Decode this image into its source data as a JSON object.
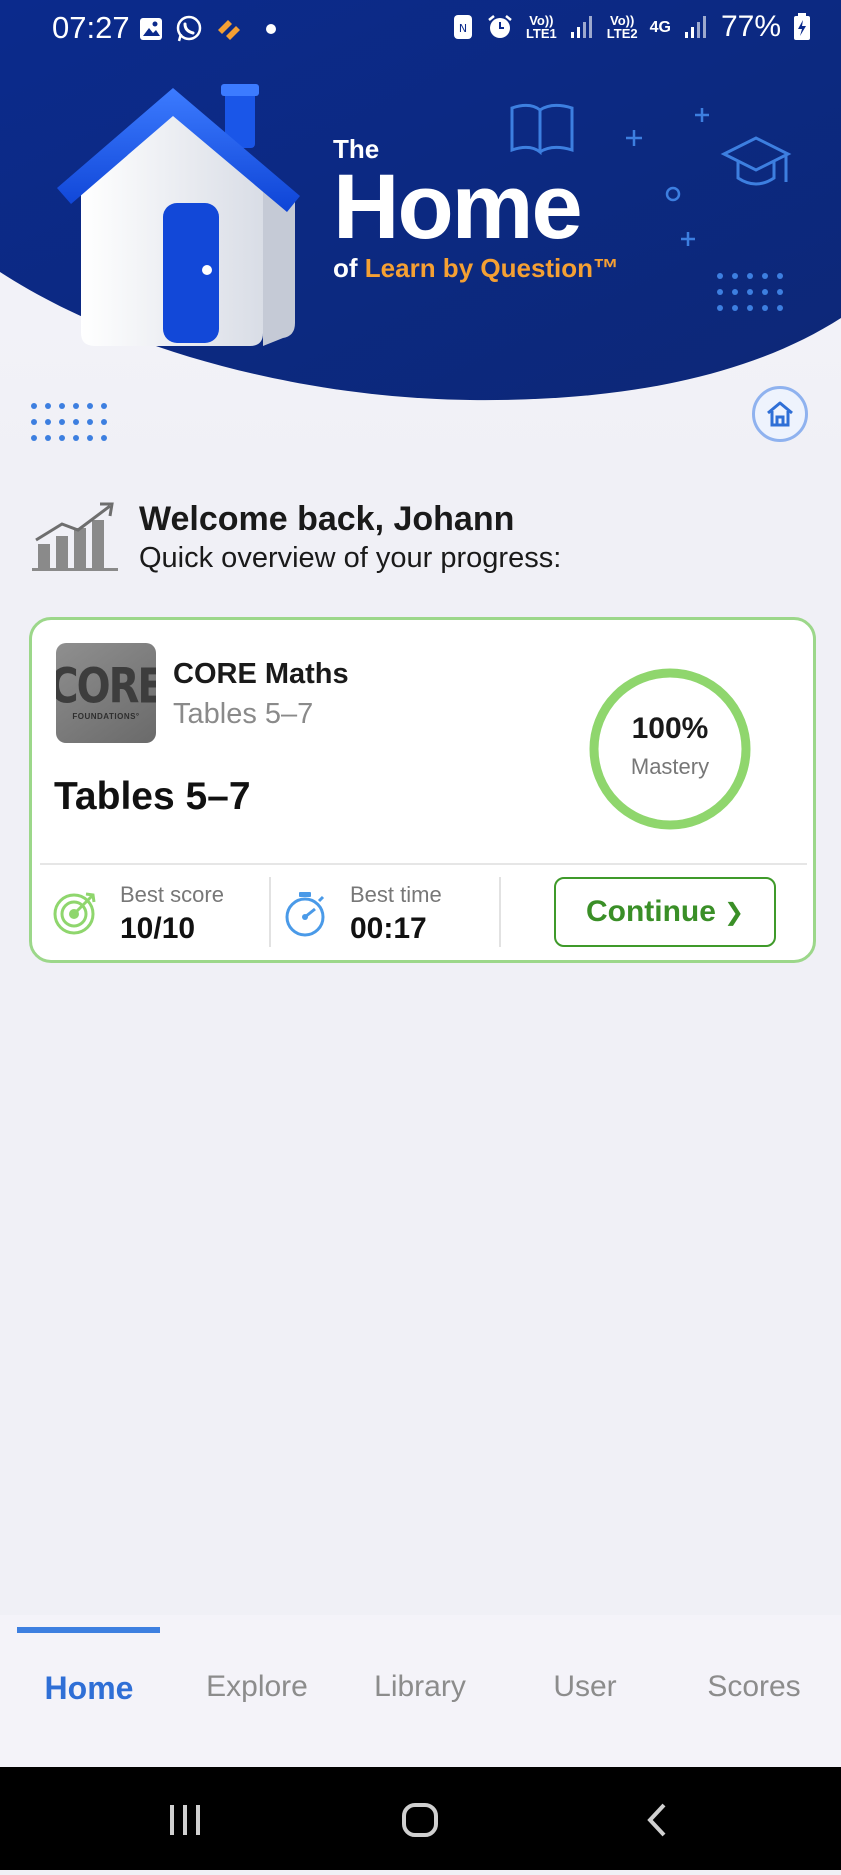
{
  "status_bar": {
    "time": "07:27",
    "battery": "77%",
    "sim1_label": "Vo))\nLTE1",
    "sim2_label": "Vo))\nLTE2",
    "net_label": "4G",
    "icons": [
      "image-icon",
      "whatsapp-icon",
      "app-notification-icon",
      "dot-icon",
      "nfc-icon",
      "alarm-icon",
      "signal-icon",
      "battery-charging-icon"
    ]
  },
  "header": {
    "brand_the": "The",
    "brand_home": "Home",
    "brand_of": "of",
    "brand_tagline": "Learn by Question™",
    "colors": {
      "primary": "#0d2a8a",
      "accent": "#f5a033",
      "icon_blue": "#3d7fe0"
    }
  },
  "welcome": {
    "title": "Welcome back, Johann",
    "subtitle": "Quick overview of your progress:"
  },
  "course_card": {
    "thumb_big": "CORE",
    "thumb_small": "FOUNDATIONS°",
    "course_name": "CORE Maths",
    "course_sub": "Tables 5–7",
    "topic_title": "Tables 5–7",
    "mastery_pct": "100%",
    "mastery_fraction": 1.0,
    "mastery_label": "Mastery",
    "best_score_label": "Best score",
    "best_score_value": "10/10",
    "best_time_label": "Best time",
    "best_time_value": "00:17",
    "continue_label": "Continue",
    "continue_chevron": "❯",
    "colors": {
      "success": "#8fd66d",
      "button_text": "#3a8f27"
    }
  },
  "bottom_nav": {
    "items": [
      {
        "label": "Home",
        "active": true
      },
      {
        "label": "Explore",
        "active": false
      },
      {
        "label": "Library",
        "active": false
      },
      {
        "label": "User",
        "active": false
      },
      {
        "label": "Scores",
        "active": false
      }
    ]
  },
  "system_nav": {
    "icons": [
      "recent-apps-icon",
      "home-circle-icon",
      "back-icon"
    ]
  }
}
